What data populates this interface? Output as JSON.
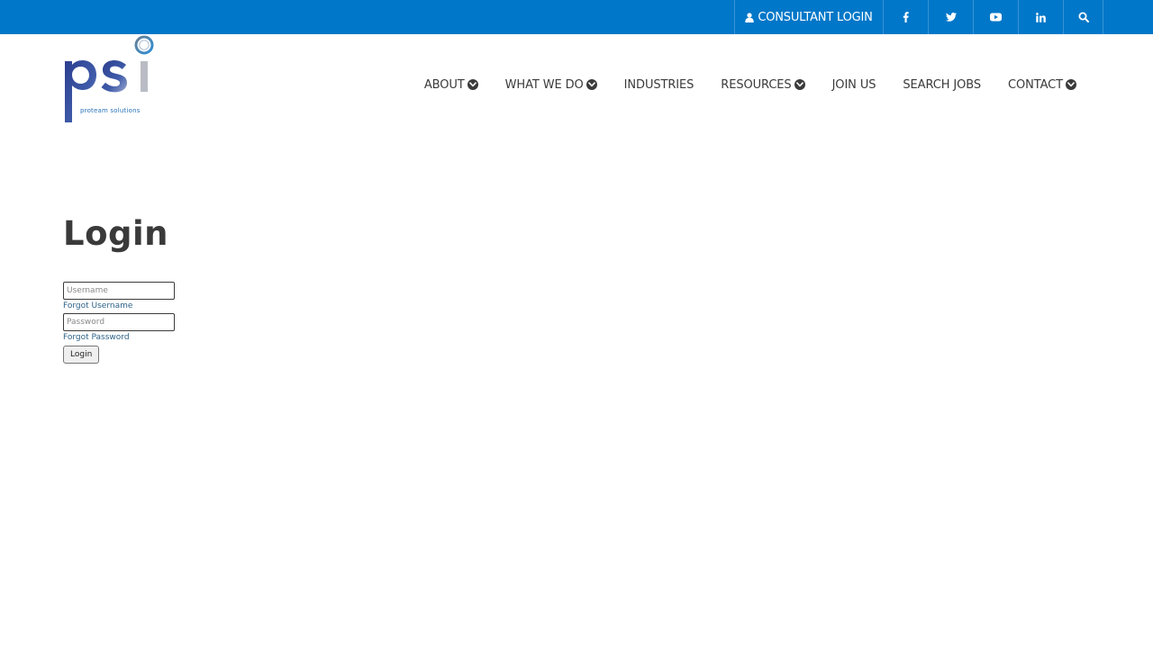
{
  "topbar": {
    "consultant_login": "CONSULTANT LOGIN",
    "icons": [
      "user-icon",
      "facebook-icon",
      "twitter-icon",
      "youtube-icon",
      "linkedin-icon",
      "search-icon"
    ]
  },
  "logo": {
    "text": "psi",
    "tagline": "proteam solutions"
  },
  "nav": {
    "items": [
      {
        "label": "ABOUT",
        "dropdown": true
      },
      {
        "label": "WHAT WE DO",
        "dropdown": true
      },
      {
        "label": "INDUSTRIES",
        "dropdown": false
      },
      {
        "label": "RESOURCES",
        "dropdown": true
      },
      {
        "label": "JOIN US",
        "dropdown": false
      },
      {
        "label": "SEARCH JOBS",
        "dropdown": false
      },
      {
        "label": "CONTACT",
        "dropdown": true
      }
    ]
  },
  "page": {
    "title": "Login"
  },
  "form": {
    "username_placeholder": "Username",
    "username_value": "",
    "forgot_username": "Forgot Username",
    "password_placeholder": "Password",
    "password_value": "",
    "forgot_password": "Forgot Password",
    "submit_label": "Login"
  },
  "colors": {
    "topbar": "#0077c8",
    "text": "#3a3a3a",
    "link": "#2c6288"
  }
}
